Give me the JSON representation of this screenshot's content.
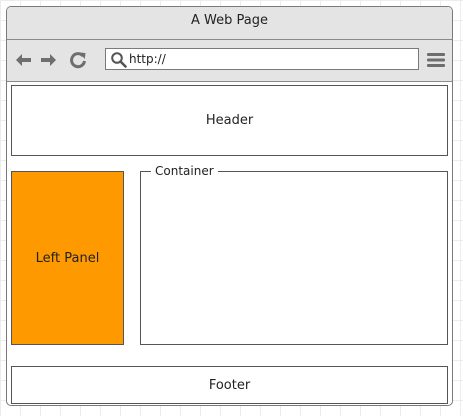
{
  "window": {
    "title": "A Web Page"
  },
  "toolbar": {
    "address_value": "http://",
    "icons": [
      "back-arrow-icon",
      "forward-arrow-icon",
      "reload-icon",
      "search-icon",
      "hamburger-menu-icon"
    ]
  },
  "layout": {
    "header_label": "Header",
    "left_panel_label": "Left Panel",
    "container_label": "Container",
    "footer_label": "Footer"
  },
  "colors": {
    "left_panel": "#ff9900",
    "chrome": "#e4e4e4",
    "icon": "#6e6e6e"
  }
}
